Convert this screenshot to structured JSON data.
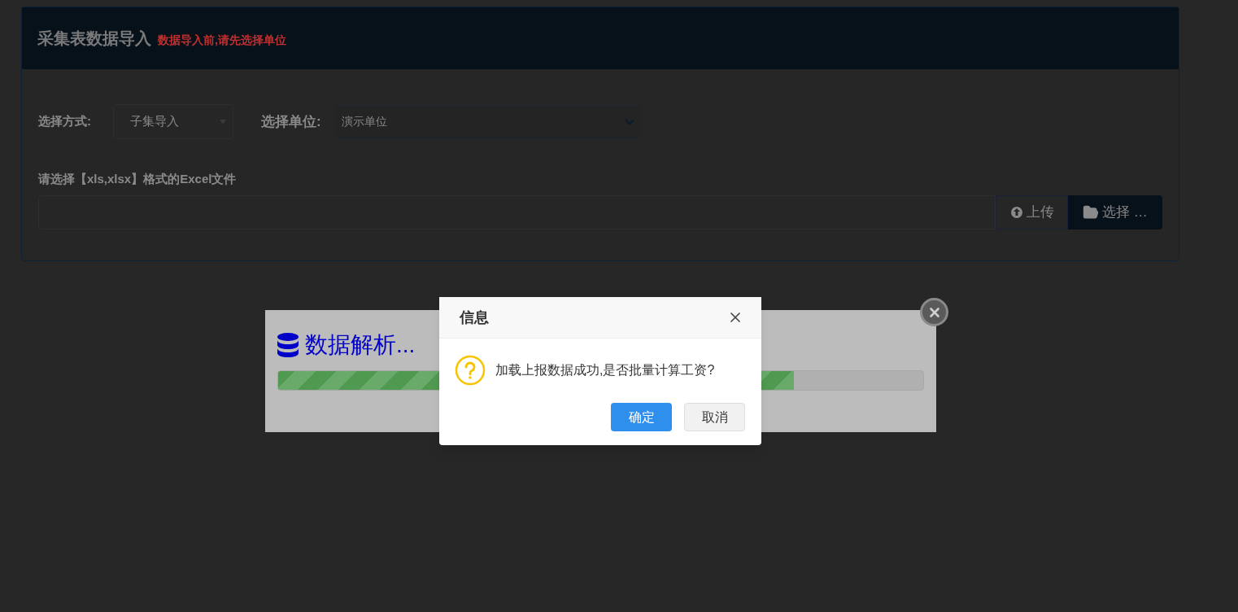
{
  "panel": {
    "title": "采集表数据导入",
    "notice": "数据导入前,请先选择单位"
  },
  "form": {
    "mode_label": "选择方式:",
    "mode_value": "子集导入",
    "unit_label": "选择单位:",
    "unit_value": "演示单位",
    "file_label": "请选择【xls,xlsx】格式的Excel文件",
    "upload_button": "上传",
    "browse_button": "选择 …"
  },
  "progress": {
    "title": "数据解析...",
    "level": 0.8
  },
  "dialog": {
    "title": "信息",
    "message": "加载上报数据成功,是否批量计算工资?",
    "buttons": [
      {
        "label": "确定",
        "kind": "primary"
      },
      {
        "label": "取消",
        "kind": "secondary"
      }
    ]
  }
}
